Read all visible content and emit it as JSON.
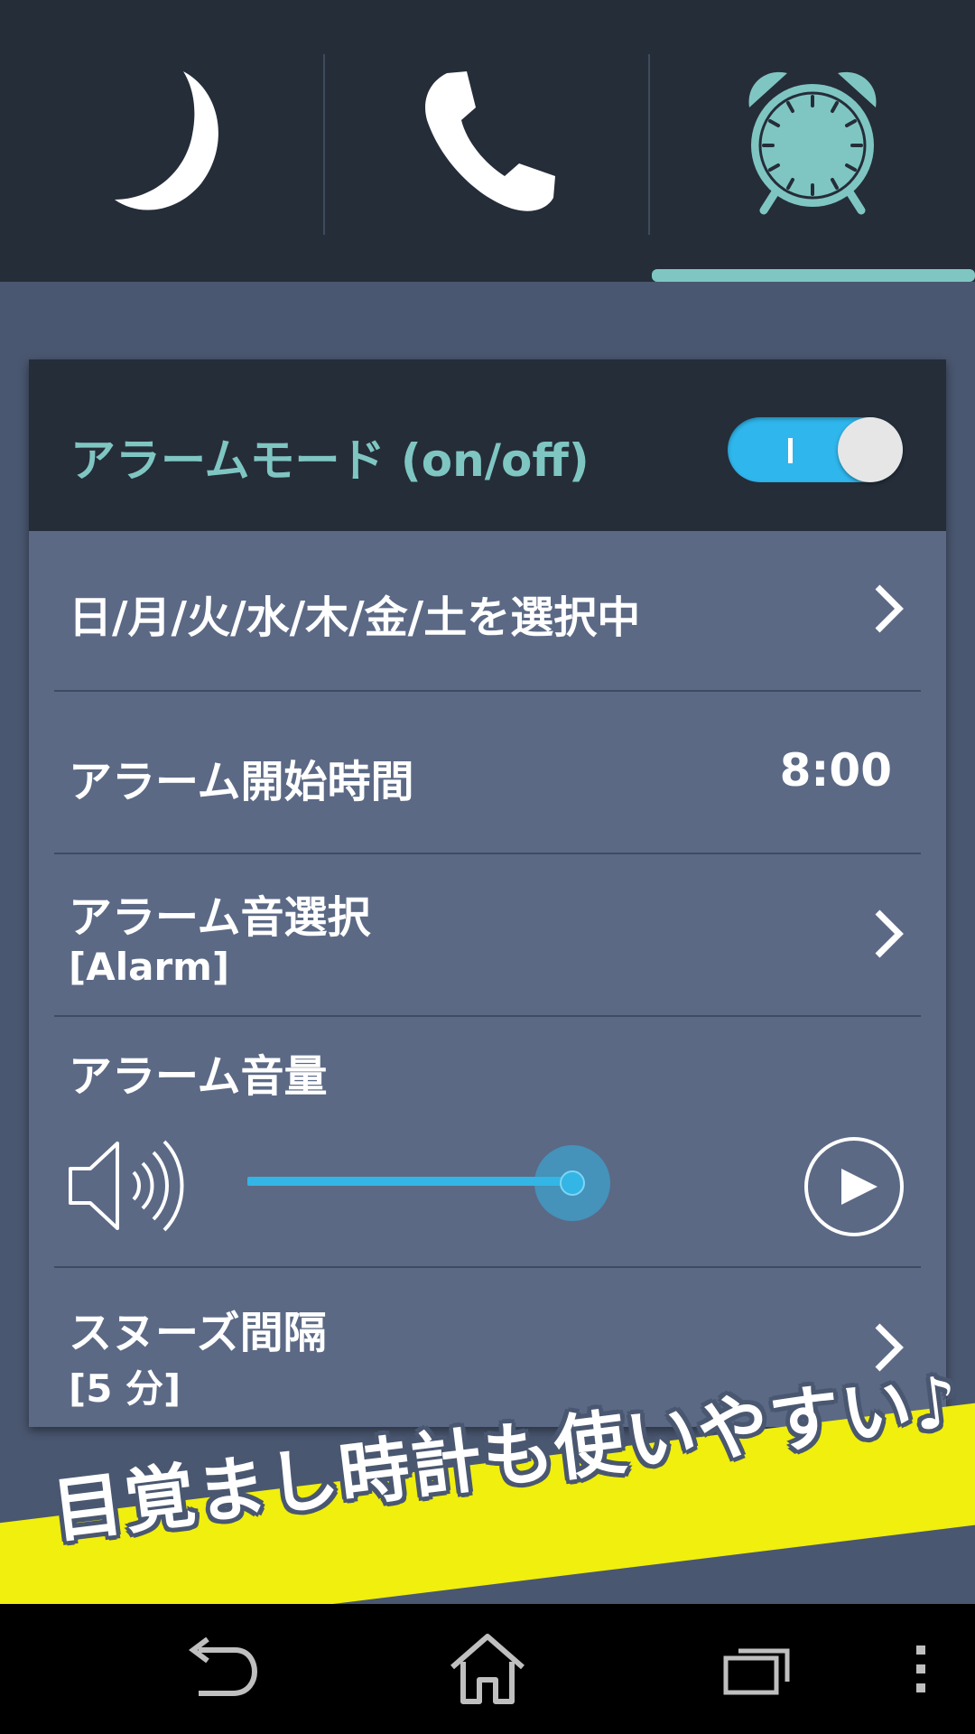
{
  "tabs": [
    {
      "name": "sleep",
      "icon": "moon-icon",
      "active": false
    },
    {
      "name": "phone",
      "icon": "phone-icon",
      "active": false
    },
    {
      "name": "alarm",
      "icon": "alarm-clock-icon",
      "active": true
    }
  ],
  "colors": {
    "accent": "#7fc6c2",
    "toggle_on": "#33b5e5",
    "card": "#5b6985",
    "header": "#252d39",
    "banner": "#f0ef0d"
  },
  "alarm_mode": {
    "label": "アラームモード (on/off)",
    "toggle_on": true,
    "toggle_mark": "I"
  },
  "settings": {
    "days": {
      "label": "日/月/火/水/木/金/土を選択中"
    },
    "start_time": {
      "label": "アラーム開始時間",
      "value": "8:00"
    },
    "sound": {
      "label": "アラーム音選択",
      "value": "[Alarm]"
    },
    "volume": {
      "label": "アラーム音量",
      "level": 0.6
    },
    "snooze": {
      "label": "スヌーズ間隔",
      "value": "[5 分]"
    }
  },
  "banner": {
    "text": "目覚まし時計も使いやすい♪"
  },
  "navbar": {
    "buttons": [
      "back-icon",
      "home-icon",
      "recent-apps-icon",
      "menu-icon"
    ]
  }
}
